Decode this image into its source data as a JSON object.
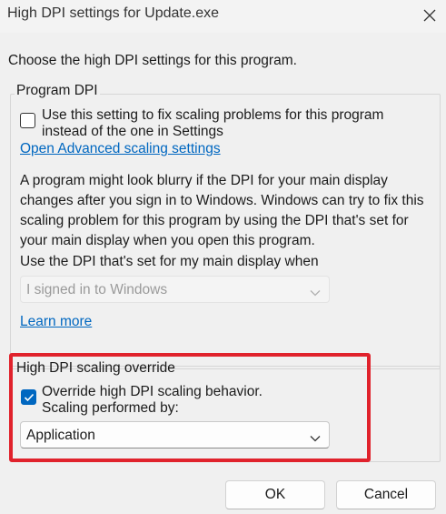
{
  "window": {
    "title": "High DPI settings for Update.exe",
    "close_icon": "close-icon"
  },
  "intro": "Choose the high DPI settings for this program.",
  "program_dpi": {
    "legend": "Program DPI",
    "checkbox": {
      "checked": false,
      "label_line1": "Use this setting to fix scaling problems for this program",
      "label_line2": "instead of the one in Settings"
    },
    "advanced_link": "Open Advanced scaling settings",
    "description": "A program might look blurry if the DPI for your main display changes after you sign in to Windows. Windows can try to fix this scaling problem for this program by using the DPI that's set for your main display when you open this program.",
    "select_label": "Use the DPI that's set for my main display when",
    "select_value": "I signed in to Windows",
    "learn_more": "Learn more"
  },
  "override": {
    "legend": "High DPI scaling override",
    "checkbox": {
      "checked": true,
      "label_line1": "Override high DPI scaling behavior.",
      "label_line2": "Scaling performed by:"
    },
    "select_value": "Application",
    "highlight_color": "#e0222c"
  },
  "buttons": {
    "ok": "OK",
    "cancel": "Cancel"
  },
  "colors": {
    "accent": "#0067c0",
    "background": "#f0f0f0"
  }
}
